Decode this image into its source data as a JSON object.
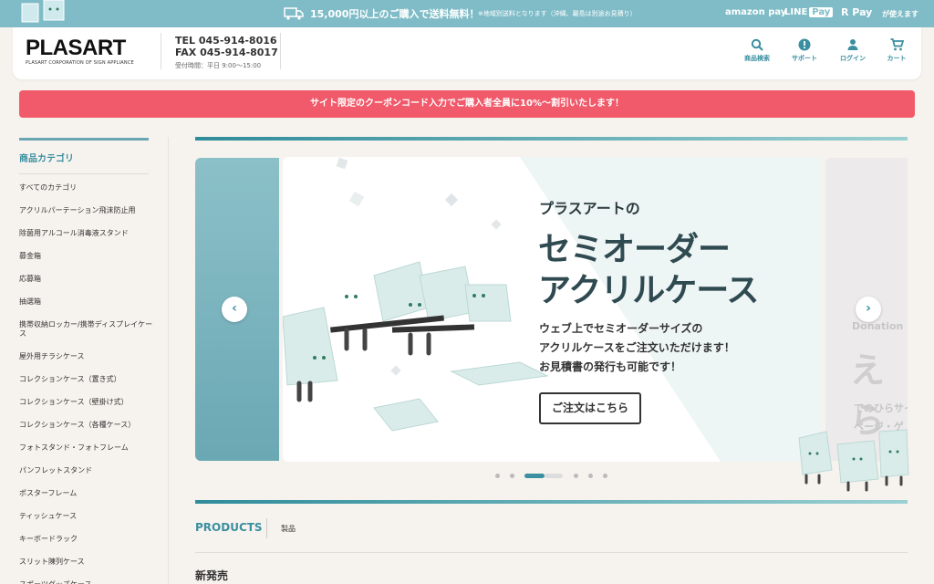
{
  "topbar": {
    "shipping": "15,000円以上のご購入で送料無料！",
    "note": "※地域別送料となります（沖縄、離島は別途お見積り）",
    "pay_amazon": "amazon pay",
    "pay_line": "LINE",
    "pay_line_badge": "Pay",
    "pay_r": "R Pay",
    "usable": "が使えます"
  },
  "header": {
    "logo": "PLASART",
    "logo_sub": "PLASART CORPORATION OF SIGN APPLIANCE",
    "tel": "TEL 045-914-8016",
    "fax": "FAX 045-914-8017",
    "hours": "受付時間：平日 9:00〜15:00",
    "nav": [
      "商品検索",
      "サポート",
      "ログイン",
      "カート"
    ]
  },
  "coupon": "サイト限定のクーポンコード入力でご購入者全員に10%〜割引いたします！",
  "sidebar": {
    "title": "商品カテゴリ",
    "items": [
      "すべてのカテゴリ",
      "アクリルパーテーション飛沫防止用",
      "除菌用アルコール消毒液スタンド",
      "募金箱",
      "応募箱",
      "抽選箱",
      "携帯収納ロッカー/携帯ディスプレイケース",
      "屋外用チラシケース",
      "コレクションケース（置き式）",
      "コレクションケース（壁掛け式）",
      "コレクションケース（各種ケース）",
      "フォトスタンド・フォトフレーム",
      "パンフレットスタンド",
      "ポスターフレーム",
      "ティッシュケース",
      "キーボードラック",
      "スリット陳列ケース",
      "スポーツグッズケース"
    ]
  },
  "slide": {
    "kicker": "プラスアートの",
    "title1": "セミオーダー",
    "title2": "アクリルケース",
    "body1": "ウェブ上でセミオーダーサイズの",
    "body2": "アクリルケースをご注文いただけます！",
    "body3": "お見積書の発行も可能です！",
    "button": "ご注文はこちら"
  },
  "next_slide": {
    "kicker": "Donation",
    "big": "えら",
    "text1": "てのひらサイ",
    "text2": "ページ・ゲ"
  },
  "carousel": {
    "prev": "‹",
    "next": "›",
    "active_index": 2,
    "count": 7
  },
  "products": {
    "title": "PRODUCTS",
    "jp": "製品",
    "new": "新発売"
  },
  "colors": {
    "accent": "#3a8fa0",
    "coupon": "#f05a6a",
    "topbar": "#7fbcc7"
  }
}
